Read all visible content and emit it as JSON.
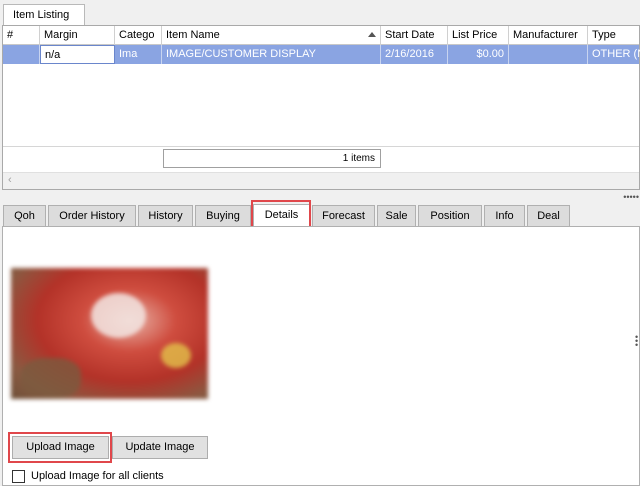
{
  "top_tab": {
    "label": "Item Listing"
  },
  "grid": {
    "columns": [
      {
        "label": "#"
      },
      {
        "label": "Margin"
      },
      {
        "label": "Catego"
      },
      {
        "label": "Item Name"
      },
      {
        "label": "Start Date"
      },
      {
        "label": "List Price"
      },
      {
        "label": "Manufacturer"
      },
      {
        "label": "Type"
      }
    ],
    "rows": [
      {
        "num": "",
        "margin": "n/a",
        "category": "Ima",
        "item_name": "IMAGE/CUSTOMER DISPLAY",
        "start_date": "2/16/2016",
        "list_price": "$0.00",
        "manufacturer": "",
        "type": "OTHER (N"
      }
    ],
    "count_label": "1 items"
  },
  "detail_tabs": [
    {
      "label": "Qoh"
    },
    {
      "label": "Order History"
    },
    {
      "label": "History"
    },
    {
      "label": "Buying"
    },
    {
      "label": "Details"
    },
    {
      "label": "Forecast"
    },
    {
      "label": "Sale"
    },
    {
      "label": "Position"
    },
    {
      "label": "Info"
    },
    {
      "label": "Deal"
    }
  ],
  "active_tab": "Details",
  "details": {
    "upload_label": "Upload Image",
    "update_label": "Update Image",
    "all_clients_label": "Upload Image for all clients"
  },
  "colors": {
    "selected_row": "#8aa4e2",
    "highlight": "#e0474b"
  }
}
